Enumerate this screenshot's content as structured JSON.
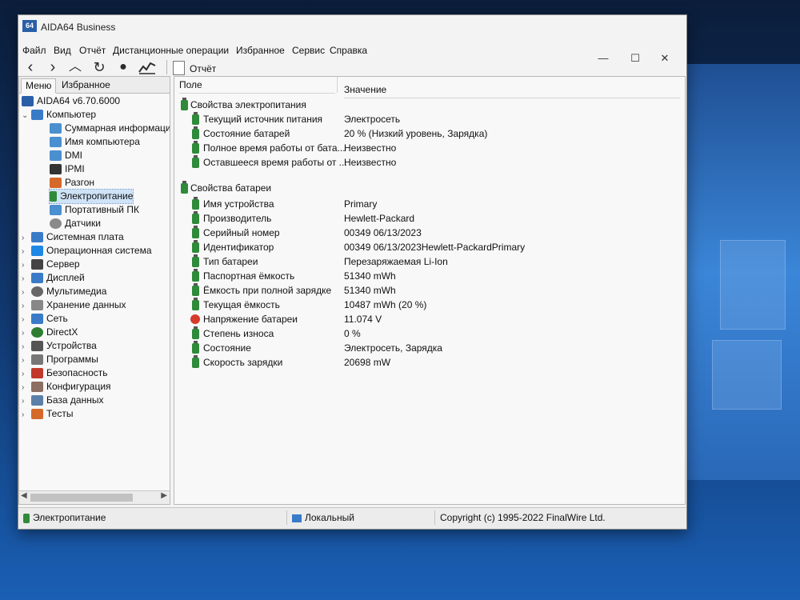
{
  "app": {
    "title": "AIDA64 Business",
    "logo": "64"
  },
  "menu": [
    "Файл",
    "Вид",
    "Отчёт",
    "Дистанционные операции",
    "Избранное",
    "Сервис",
    "Справка"
  ],
  "toolbar": {
    "report_label": "Отчёт"
  },
  "tabs": {
    "menu": "Меню",
    "favorites": "Избранное"
  },
  "tree": {
    "root": "AIDA64 v6.70.6000",
    "computer": "Компьютер",
    "computer_children": [
      "Суммарная информация",
      "Имя компьютера",
      "DMI",
      "IPMI",
      "Разгон",
      "Электропитание",
      "Портативный ПК",
      "Датчики"
    ],
    "sections": [
      "Системная плата",
      "Операционная система",
      "Сервер",
      "Дисплей",
      "Мультимедиа",
      "Хранение данных",
      "Сеть",
      "DirectX",
      "Устройства",
      "Программы",
      "Безопасность",
      "Конфигурация",
      "База данных",
      "Тесты"
    ]
  },
  "columns": {
    "field": "Поле",
    "value": "Значение"
  },
  "groups": {
    "power": {
      "title": "Свойства электропитания",
      "rows": [
        {
          "field": "Текущий источник питания",
          "value": "Электросеть"
        },
        {
          "field": "Состояние батарей",
          "value": "20 % (Низкий уровень, Зарядка)"
        },
        {
          "field": "Полное время работы от бата...",
          "value": "Неизвестно"
        },
        {
          "field": "Оставшееся время работы от ...",
          "value": "Неизвестно"
        }
      ]
    },
    "battery": {
      "title": "Свойства батареи",
      "rows": [
        {
          "field": "Имя устройства",
          "value": "Primary"
        },
        {
          "field": "Производитель",
          "value": "Hewlett-Packard"
        },
        {
          "field": "Серийный номер",
          "value": "00349 06/13/2023"
        },
        {
          "field": "Идентификатор",
          "value": "00349 06/13/2023Hewlett-PackardPrimary"
        },
        {
          "field": "Тип батареи",
          "value": "Перезаряжаемая Li-Ion"
        },
        {
          "field": "Паспортная ёмкость",
          "value": "51340 mWh"
        },
        {
          "field": "Ёмкость при полной зарядке",
          "value": "51340 mWh"
        },
        {
          "field": "Текущая ёмкость",
          "value": "10487 mWh  (20 %)"
        },
        {
          "field": "Напряжение батареи",
          "value": "11.074 V"
        },
        {
          "field": "Степень износа",
          "value": "0 %"
        },
        {
          "field": "Состояние",
          "value": "Электросеть, Зарядка"
        },
        {
          "field": "Скорость зарядки",
          "value": "20698 mW"
        }
      ]
    }
  },
  "status": {
    "left": "Электропитание",
    "middle": "Локальный",
    "right": "Copyright (c) 1995-2022 FinalWire Ltd."
  },
  "colors": {
    "selection": "#cfe3f7",
    "accent": "#2a5fa8",
    "power_icon": "#2f8a3a"
  }
}
